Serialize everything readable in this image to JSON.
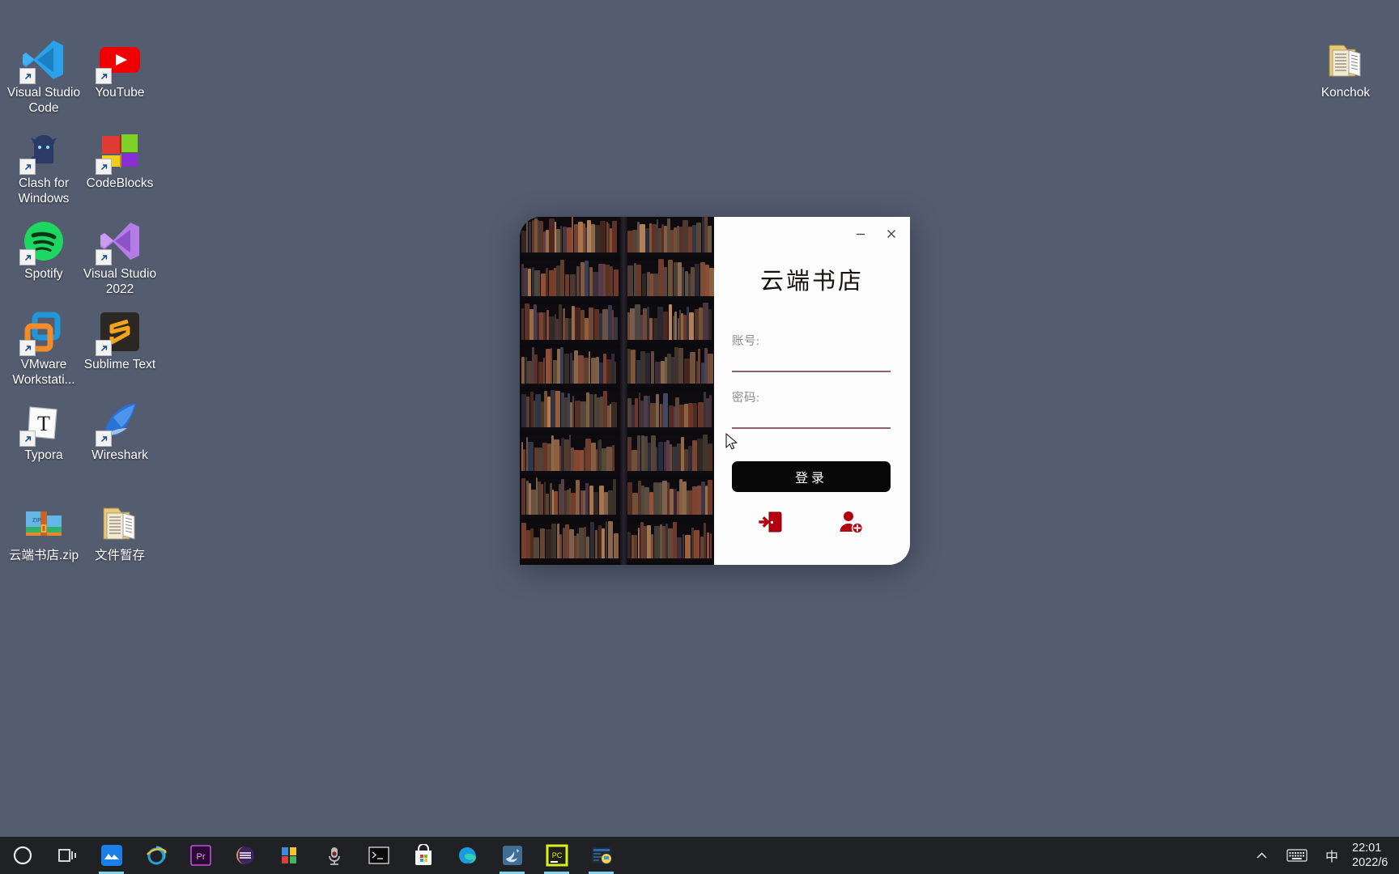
{
  "desktop": {
    "background_color": "#545c70",
    "icons": [
      {
        "name": "visual-studio-code",
        "label": "Visual Studio Code",
        "icon": "vscode-icon",
        "shortcut": true,
        "col": 0,
        "row": 0
      },
      {
        "name": "youtube",
        "label": "YouTube",
        "icon": "youtube-icon",
        "shortcut": true,
        "col": 1,
        "row": 0
      },
      {
        "name": "clash-for-windows",
        "label": "Clash for Windows",
        "icon": "clash-icon",
        "shortcut": true,
        "col": 0,
        "row": 1
      },
      {
        "name": "codeblocks",
        "label": "CodeBlocks",
        "icon": "codeblocks-icon",
        "shortcut": true,
        "col": 1,
        "row": 1
      },
      {
        "name": "spotify",
        "label": "Spotify",
        "icon": "spotify-icon",
        "shortcut": true,
        "col": 0,
        "row": 2
      },
      {
        "name": "visual-studio-2022",
        "label": "Visual Studio 2022",
        "icon": "visual-studio-icon",
        "shortcut": true,
        "col": 1,
        "row": 2
      },
      {
        "name": "vmware-workstation",
        "label": "VMware Workstati...",
        "icon": "vmware-icon",
        "shortcut": true,
        "col": 0,
        "row": 3
      },
      {
        "name": "sublime-text",
        "label": "Sublime Text",
        "icon": "sublime-icon",
        "shortcut": true,
        "col": 1,
        "row": 3
      },
      {
        "name": "typora",
        "label": "Typora",
        "icon": "typora-icon",
        "shortcut": true,
        "col": 0,
        "row": 4
      },
      {
        "name": "wireshark",
        "label": "Wireshark",
        "icon": "wireshark-icon",
        "shortcut": true,
        "col": 1,
        "row": 4
      },
      {
        "name": "yunduan-shudian-zip",
        "label": "云端书店.zip",
        "icon": "zip-archive-icon",
        "shortcut": false,
        "col": 0,
        "row": 5
      },
      {
        "name": "wenjian-zancun",
        "label": "文件暂存",
        "icon": "folder-icon",
        "shortcut": false,
        "col": 1,
        "row": 5
      }
    ],
    "corner_icon": {
      "name": "konchok-folder",
      "label": "Konchok",
      "icon": "folder-icon"
    }
  },
  "login_window": {
    "title": "云端书店",
    "titlebar": {
      "minimize_label": "—",
      "minimize_icon": "minimize-icon",
      "close_label": "✕",
      "close_icon": "close-icon"
    },
    "fields": [
      {
        "name": "account",
        "label": "账号:",
        "value": "",
        "placeholder": ""
      },
      {
        "name": "password",
        "label": "密码:",
        "value": "",
        "placeholder": ""
      }
    ],
    "login_button_label": "登录",
    "actions": [
      {
        "name": "exit",
        "icon": "exit-door-icon",
        "color": "#b4000f"
      },
      {
        "name": "register",
        "icon": "add-user-icon",
        "color": "#b4000f"
      }
    ],
    "accent_underline_color": "#8c5f77",
    "button_color": "#070707"
  },
  "taskbar": {
    "background_color": "#202124",
    "items": [
      {
        "name": "cortana",
        "icon": "cortana-circle-icon",
        "running": false
      },
      {
        "name": "task-view",
        "icon": "task-view-icon",
        "running": false
      },
      {
        "name": "motrix",
        "icon": "mountain-app-icon",
        "running": true
      },
      {
        "name": "internet-explorer",
        "icon": "internet-explorer-icon",
        "running": false
      },
      {
        "name": "premiere-pro",
        "icon": "premiere-pro-icon",
        "running": false
      },
      {
        "name": "eclipse",
        "icon": "eclipse-icon",
        "running": false
      },
      {
        "name": "onenote",
        "icon": "onenote-icon",
        "running": false
      },
      {
        "name": "microphone",
        "icon": "microphone-icon",
        "running": false
      },
      {
        "name": "command-prompt",
        "icon": "command-prompt-icon",
        "running": false
      },
      {
        "name": "microsoft-store",
        "icon": "microsoft-store-icon",
        "running": false
      },
      {
        "name": "microsoft-edge",
        "icon": "edge-icon",
        "running": false
      },
      {
        "name": "mysql-workbench",
        "icon": "dolphin-icon",
        "running": true
      },
      {
        "name": "pycharm",
        "icon": "pycharm-icon",
        "running": true
      },
      {
        "name": "python-ide",
        "icon": "python-ide-icon",
        "running": true
      }
    ],
    "tray": {
      "show_hidden_label": "︿",
      "show_hidden_icon": "chevron-up-icon",
      "keyboard_icon": "keyboard-icon",
      "ime_label": "中",
      "time": "22:01",
      "date": "2022/6"
    }
  }
}
